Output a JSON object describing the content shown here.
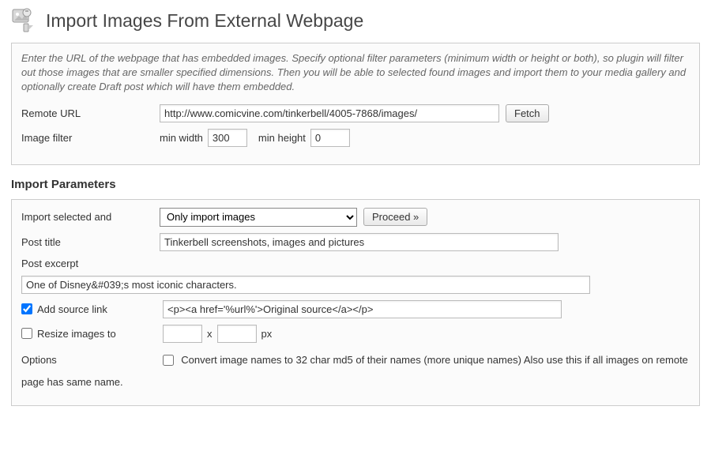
{
  "page": {
    "title": "Import Images From External Webpage"
  },
  "help": {
    "text": "Enter the URL of the webpage that has embedded images. Specify optional filter parameters (minimum width or height or both), so plugin will filter out those images that are smaller specified dimensions. Then you will be able to selected found images and import them to your media gallery and optionally create Draft post which will have them embedded."
  },
  "remote": {
    "label": "Remote URL",
    "value": "http://www.comicvine.com/tinkerbell/4005-7868/images/",
    "fetch_label": "Fetch"
  },
  "filter": {
    "label": "Image filter",
    "min_width_label": "min width",
    "min_width_value": "300",
    "min_height_label": "min height",
    "min_height_value": "0"
  },
  "import_heading": "Import Parameters",
  "import": {
    "mode_label": "Import selected and",
    "mode_value": "Only import images",
    "proceed_label": "Proceed »"
  },
  "post_title": {
    "label": "Post title",
    "value": "Tinkerbell screenshots, images and pictures"
  },
  "post_excerpt": {
    "label": "Post excerpt",
    "value": "One of Disney&#039;s most iconic characters."
  },
  "source_link": {
    "label": "Add source link",
    "value": "<p><a href='%url%'>Original source</a></p>"
  },
  "resize": {
    "label": "Resize images to",
    "width": "",
    "height": "",
    "px_label": "px"
  },
  "options": {
    "label": "Options",
    "md5_label": "Convert image names to 32 char md5 of their names (more unique names)",
    "note": "Also use this if all images on remote page has same name."
  }
}
